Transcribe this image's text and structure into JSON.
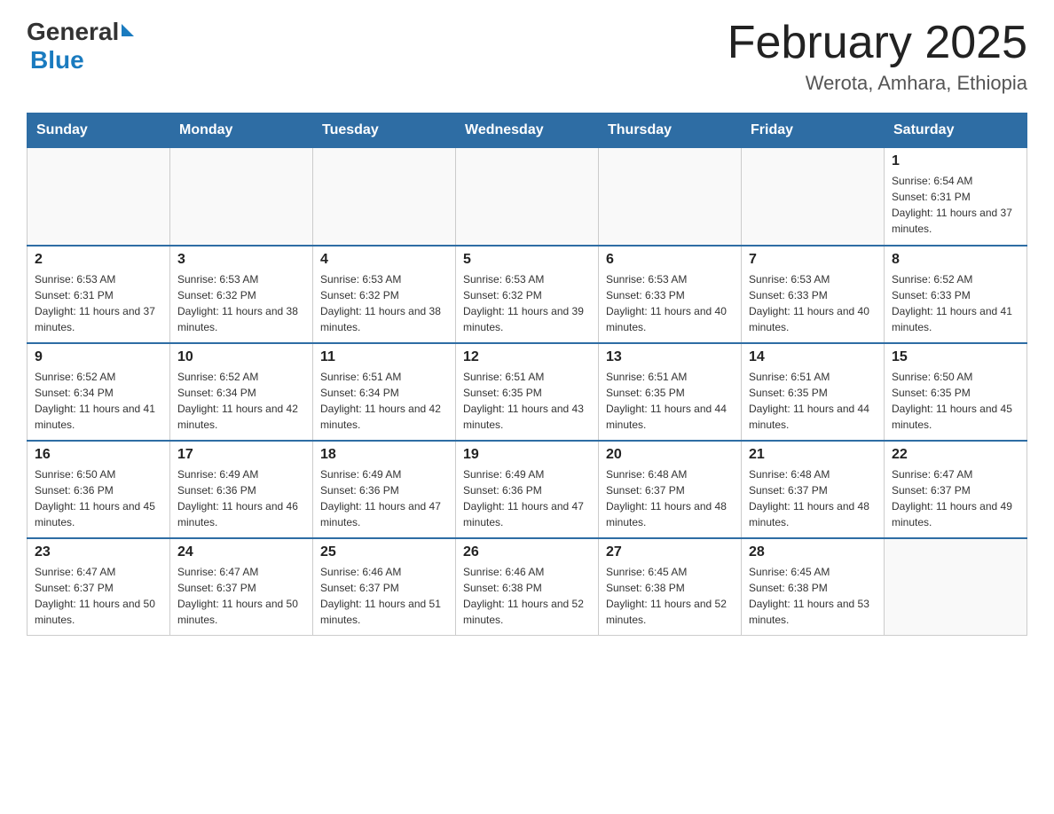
{
  "header": {
    "logo_general": "General",
    "logo_blue": "Blue",
    "month_title": "February 2025",
    "location": "Werota, Amhara, Ethiopia"
  },
  "weekdays": [
    "Sunday",
    "Monday",
    "Tuesday",
    "Wednesday",
    "Thursday",
    "Friday",
    "Saturday"
  ],
  "weeks": [
    [
      {
        "day": "",
        "sunrise": "",
        "sunset": "",
        "daylight": ""
      },
      {
        "day": "",
        "sunrise": "",
        "sunset": "",
        "daylight": ""
      },
      {
        "day": "",
        "sunrise": "",
        "sunset": "",
        "daylight": ""
      },
      {
        "day": "",
        "sunrise": "",
        "sunset": "",
        "daylight": ""
      },
      {
        "day": "",
        "sunrise": "",
        "sunset": "",
        "daylight": ""
      },
      {
        "day": "",
        "sunrise": "",
        "sunset": "",
        "daylight": ""
      },
      {
        "day": "1",
        "sunrise": "Sunrise: 6:54 AM",
        "sunset": "Sunset: 6:31 PM",
        "daylight": "Daylight: 11 hours and 37 minutes."
      }
    ],
    [
      {
        "day": "2",
        "sunrise": "Sunrise: 6:53 AM",
        "sunset": "Sunset: 6:31 PM",
        "daylight": "Daylight: 11 hours and 37 minutes."
      },
      {
        "day": "3",
        "sunrise": "Sunrise: 6:53 AM",
        "sunset": "Sunset: 6:32 PM",
        "daylight": "Daylight: 11 hours and 38 minutes."
      },
      {
        "day": "4",
        "sunrise": "Sunrise: 6:53 AM",
        "sunset": "Sunset: 6:32 PM",
        "daylight": "Daylight: 11 hours and 38 minutes."
      },
      {
        "day": "5",
        "sunrise": "Sunrise: 6:53 AM",
        "sunset": "Sunset: 6:32 PM",
        "daylight": "Daylight: 11 hours and 39 minutes."
      },
      {
        "day": "6",
        "sunrise": "Sunrise: 6:53 AM",
        "sunset": "Sunset: 6:33 PM",
        "daylight": "Daylight: 11 hours and 40 minutes."
      },
      {
        "day": "7",
        "sunrise": "Sunrise: 6:53 AM",
        "sunset": "Sunset: 6:33 PM",
        "daylight": "Daylight: 11 hours and 40 minutes."
      },
      {
        "day": "8",
        "sunrise": "Sunrise: 6:52 AM",
        "sunset": "Sunset: 6:33 PM",
        "daylight": "Daylight: 11 hours and 41 minutes."
      }
    ],
    [
      {
        "day": "9",
        "sunrise": "Sunrise: 6:52 AM",
        "sunset": "Sunset: 6:34 PM",
        "daylight": "Daylight: 11 hours and 41 minutes."
      },
      {
        "day": "10",
        "sunrise": "Sunrise: 6:52 AM",
        "sunset": "Sunset: 6:34 PM",
        "daylight": "Daylight: 11 hours and 42 minutes."
      },
      {
        "day": "11",
        "sunrise": "Sunrise: 6:51 AM",
        "sunset": "Sunset: 6:34 PM",
        "daylight": "Daylight: 11 hours and 42 minutes."
      },
      {
        "day": "12",
        "sunrise": "Sunrise: 6:51 AM",
        "sunset": "Sunset: 6:35 PM",
        "daylight": "Daylight: 11 hours and 43 minutes."
      },
      {
        "day": "13",
        "sunrise": "Sunrise: 6:51 AM",
        "sunset": "Sunset: 6:35 PM",
        "daylight": "Daylight: 11 hours and 44 minutes."
      },
      {
        "day": "14",
        "sunrise": "Sunrise: 6:51 AM",
        "sunset": "Sunset: 6:35 PM",
        "daylight": "Daylight: 11 hours and 44 minutes."
      },
      {
        "day": "15",
        "sunrise": "Sunrise: 6:50 AM",
        "sunset": "Sunset: 6:35 PM",
        "daylight": "Daylight: 11 hours and 45 minutes."
      }
    ],
    [
      {
        "day": "16",
        "sunrise": "Sunrise: 6:50 AM",
        "sunset": "Sunset: 6:36 PM",
        "daylight": "Daylight: 11 hours and 45 minutes."
      },
      {
        "day": "17",
        "sunrise": "Sunrise: 6:49 AM",
        "sunset": "Sunset: 6:36 PM",
        "daylight": "Daylight: 11 hours and 46 minutes."
      },
      {
        "day": "18",
        "sunrise": "Sunrise: 6:49 AM",
        "sunset": "Sunset: 6:36 PM",
        "daylight": "Daylight: 11 hours and 47 minutes."
      },
      {
        "day": "19",
        "sunrise": "Sunrise: 6:49 AM",
        "sunset": "Sunset: 6:36 PM",
        "daylight": "Daylight: 11 hours and 47 minutes."
      },
      {
        "day": "20",
        "sunrise": "Sunrise: 6:48 AM",
        "sunset": "Sunset: 6:37 PM",
        "daylight": "Daylight: 11 hours and 48 minutes."
      },
      {
        "day": "21",
        "sunrise": "Sunrise: 6:48 AM",
        "sunset": "Sunset: 6:37 PM",
        "daylight": "Daylight: 11 hours and 48 minutes."
      },
      {
        "day": "22",
        "sunrise": "Sunrise: 6:47 AM",
        "sunset": "Sunset: 6:37 PM",
        "daylight": "Daylight: 11 hours and 49 minutes."
      }
    ],
    [
      {
        "day": "23",
        "sunrise": "Sunrise: 6:47 AM",
        "sunset": "Sunset: 6:37 PM",
        "daylight": "Daylight: 11 hours and 50 minutes."
      },
      {
        "day": "24",
        "sunrise": "Sunrise: 6:47 AM",
        "sunset": "Sunset: 6:37 PM",
        "daylight": "Daylight: 11 hours and 50 minutes."
      },
      {
        "day": "25",
        "sunrise": "Sunrise: 6:46 AM",
        "sunset": "Sunset: 6:37 PM",
        "daylight": "Daylight: 11 hours and 51 minutes."
      },
      {
        "day": "26",
        "sunrise": "Sunrise: 6:46 AM",
        "sunset": "Sunset: 6:38 PM",
        "daylight": "Daylight: 11 hours and 52 minutes."
      },
      {
        "day": "27",
        "sunrise": "Sunrise: 6:45 AM",
        "sunset": "Sunset: 6:38 PM",
        "daylight": "Daylight: 11 hours and 52 minutes."
      },
      {
        "day": "28",
        "sunrise": "Sunrise: 6:45 AM",
        "sunset": "Sunset: 6:38 PM",
        "daylight": "Daylight: 11 hours and 53 minutes."
      },
      {
        "day": "",
        "sunrise": "",
        "sunset": "",
        "daylight": ""
      }
    ]
  ]
}
